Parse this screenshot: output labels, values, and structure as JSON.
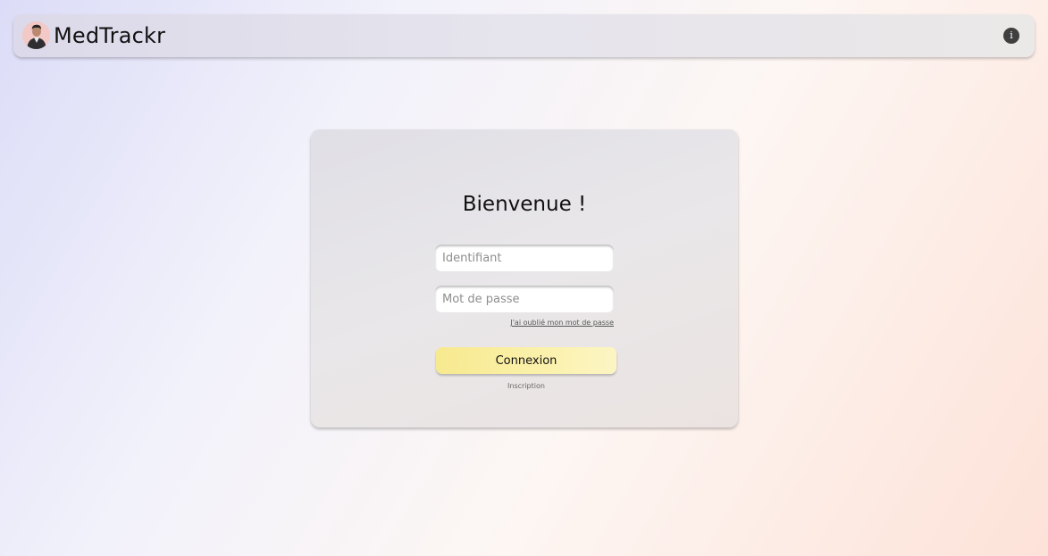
{
  "app": {
    "brand": "MedTrackr",
    "info_icon": "info-icon",
    "info_glyph": "i",
    "avatar_icon": "user-avatar"
  },
  "login": {
    "title": "Bienvenue !",
    "username_placeholder": "Identifiant",
    "username_value": "",
    "password_placeholder": "Mot de passe",
    "password_value": "",
    "forgot_link": "J'ai oublié mon mot de passe",
    "submit_label": "Connexion",
    "signup_link": "Inscription"
  },
  "colors": {
    "button_yellow": "#f7e98f",
    "info_dark": "#3f3f3f",
    "avatar_bg": "#f2c9c6"
  }
}
